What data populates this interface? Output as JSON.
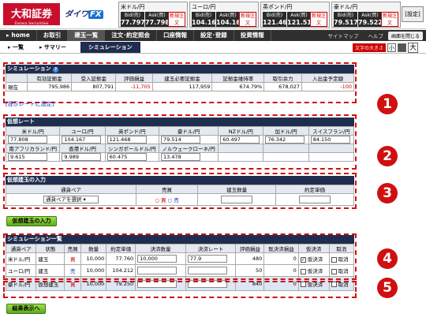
{
  "header": {
    "logo_main": "大和証券",
    "logo_sub": "Daiwa Securities",
    "logo_fx_prefix": "ダイワ",
    "logo_fx_suffix": "FX",
    "settings_label": "[設定]",
    "tickers": [
      {
        "name": "米ドル/円",
        "bid_label": "Bid(売)",
        "bid": "77.797",
        "ask_label": "Ask(買)",
        "ask": "77.798",
        "new_label": "新規注文"
      },
      {
        "name": "ユーロ/円",
        "bid_label": "Bid(売)",
        "bid": "104.164",
        "ask_label": "Ask(買)",
        "ask": "104.168",
        "new_label": "新規注文"
      },
      {
        "name": "英ポンド/円",
        "bid_label": "Bid(売)",
        "bid": "121.465",
        "ask_label": "Ask(買)",
        "ask": "121.515",
        "new_label": "新規注文"
      },
      {
        "name": "豪ドル/円",
        "bid_label": "Bid(売)",
        "bid": "79.517",
        "ask_label": "Ask(買)",
        "ask": "79.522",
        "new_label": "新規注文"
      }
    ]
  },
  "nav": {
    "items": [
      "home",
      "お取引",
      "建玉一覧",
      "注文･約定照会",
      "口座情報",
      "設定･登録",
      "投資情報"
    ],
    "links": [
      "サイトマップ",
      "ヘルプ"
    ],
    "close_label": "画面を閉じる"
  },
  "subnav": {
    "items": [
      "一覧",
      "サマリー",
      "シミュレーション"
    ],
    "font_label": "文字の大きさ",
    "sizes": [
      "小",
      "中",
      "大"
    ]
  },
  "summary": {
    "title": "シミュレーション",
    "headers": [
      "",
      "有効証拠金",
      "受入証拠金",
      "評価損益",
      "建玉必要証拠金",
      "証拠金維持率",
      "取引余力",
      "入出金予定額"
    ],
    "row": [
      "現在",
      "795,986",
      "807,791",
      "-11,705",
      "117,959",
      "674.79%",
      "678,027",
      "-100"
    ],
    "link": "[提示レートに設定]"
  },
  "virtual_rate": {
    "title": "仮想レート",
    "headers1": [
      "米ドル/円",
      "ユーロ/円",
      "英ポンド/円",
      "豪ドル/円",
      "NZドル/円",
      "加ドル/円",
      "スイスフラン/円"
    ],
    "values1": [
      "77.808",
      "104.167",
      "121.468",
      "79.514",
      "60.497",
      "76.342",
      "84.150"
    ],
    "headers2": [
      "南アフリカランド/円",
      "香港ドル/円",
      "シンガポールドル/円",
      "ノルウェークローネ/円"
    ],
    "values2": [
      "9.615",
      "9.989",
      "60.475",
      "13.478"
    ]
  },
  "virtual_position": {
    "title": "仮想建玉の入力",
    "headers": [
      "通貨ペア",
      "売買",
      "建玉数量",
      "約定単価"
    ],
    "pair_placeholder": "通貨ペアを選択",
    "buy_label": "買",
    "sell_label": "売",
    "button": "仮想建玉の入力"
  },
  "sim_list": {
    "title": "シミュレーション一覧",
    "headers": [
      "通貨ペア",
      "状態",
      "売買",
      "数量",
      "約定単価",
      "決済数量",
      "決済レート",
      "評価損益",
      "既決済損益",
      "仮決済",
      "取消"
    ],
    "rows": [
      {
        "pair": "米ドル/円",
        "state": "建玉",
        "side": "買",
        "qty": "10,000",
        "price": "77.760",
        "close_qty": "10,000",
        "close_rate": "77.9",
        "pl": "480",
        "realized": "0",
        "temp_label": "仮決済",
        "temp_checked": true,
        "cancel_label": "取消"
      },
      {
        "pair": "ユーロ/円",
        "state": "建玉",
        "side": "売",
        "qty": "10,000",
        "price": "104.212",
        "close_qty": "",
        "close_rate": "",
        "pl": "50",
        "realized": "0",
        "temp_label": "仮決済",
        "temp_checked": false,
        "cancel_label": "取消"
      },
      {
        "pair": "豪ドル/円",
        "state": "仮想建玉",
        "side": "買",
        "qty": "10,000",
        "price": "79.250",
        "close_qty": "",
        "close_rate": "",
        "pl": "840",
        "realized": "0",
        "temp_label": "仮決済",
        "temp_checked": false,
        "cancel_label": "取消"
      }
    ],
    "button": "結果表示へ"
  },
  "markers": [
    "1",
    "2",
    "3",
    "4",
    "5"
  ],
  "colors": {
    "accent": "#d01010",
    "nav": "#2f2f2f",
    "section": "#1f2d4e",
    "button": "#7cc535"
  }
}
